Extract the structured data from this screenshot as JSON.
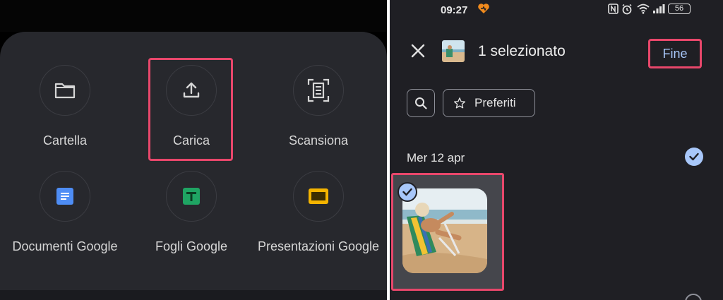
{
  "left_panel": {
    "grid_items": [
      {
        "label": "Cartella",
        "icon": "folder-icon"
      },
      {
        "label": "Carica",
        "icon": "upload-icon"
      },
      {
        "label": "Scansiona",
        "icon": "scan-icon"
      },
      {
        "label": "Documenti Google",
        "icon": "google-docs-icon"
      },
      {
        "label": "Fogli Google",
        "icon": "google-sheets-icon"
      },
      {
        "label": "Presentazioni Google",
        "icon": "google-slides-icon"
      }
    ],
    "highlight_color": "#e8476b"
  },
  "right_panel": {
    "status_bar": {
      "time": "09:27",
      "battery": "56"
    },
    "header": {
      "title": "1 selezionato",
      "done_label": "Fine"
    },
    "filters": {
      "favorites_label": "Preferiti"
    },
    "section": {
      "date_label": "Mer 12 apr"
    },
    "colors": {
      "accent": "#a8c7fa",
      "background": "#1f1f24"
    }
  }
}
